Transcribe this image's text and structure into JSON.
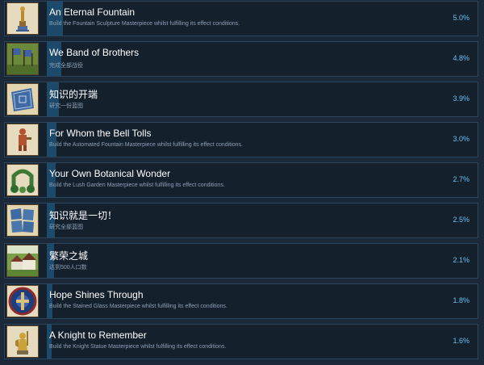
{
  "achievements": [
    {
      "title": "An Eternal Fountain",
      "description": "Build the Fountain Sculpture Masterpiece whilst fulfilling its effect conditions.",
      "percent_label": "5.0%",
      "percent": 5.0,
      "icon": "fountain-sculpture-icon"
    },
    {
      "title": "We Band of Brothers",
      "description": "完成全部战役",
      "percent_label": "4.8%",
      "percent": 4.8,
      "icon": "banners-field-icon"
    },
    {
      "title": "知识的开端",
      "description": "研究一份蓝图",
      "percent_label": "3.9%",
      "percent": 3.9,
      "icon": "blueprint-icon"
    },
    {
      "title": "For Whom the Bell Tolls",
      "description": "Build the Automated Fountain Masterpiece whilst fulfilling its effect conditions.",
      "percent_label": "3.0%",
      "percent": 3.0,
      "icon": "bell-ringer-icon"
    },
    {
      "title": "Your Own Botanical Wonder",
      "description": "Build the Lush Garden Masterpiece whilst fulfilling its effect conditions.",
      "percent_label": "2.7%",
      "percent": 2.7,
      "icon": "garden-arch-icon"
    },
    {
      "title": "知识就是一切！",
      "description": "研究全部蓝图",
      "percent_label": "2.5%",
      "percent": 2.5,
      "icon": "blueprints-stack-icon"
    },
    {
      "title": "繁荣之城",
      "description": "达到500人口数",
      "percent_label": "2.1%",
      "percent": 2.1,
      "icon": "town-houses-icon"
    },
    {
      "title": "Hope Shines Through",
      "description": "Build the Stained Glass Masterpiece whilst fulfilling its effect conditions.",
      "percent_label": "1.8%",
      "percent": 1.8,
      "icon": "stained-glass-icon"
    },
    {
      "title": "A Knight to Remember",
      "description": "Build the Knight Statue Masterpiece whilst fulfilling its effect conditions.",
      "percent_label": "1.6%",
      "percent": 1.6,
      "icon": "knight-statue-icon"
    }
  ],
  "colors": {
    "background": "#1b2838",
    "row": "#15202d",
    "row_border": "#2a475e",
    "bar_fill": "#1d4a6b",
    "title": "#ffffff",
    "description": "#8ba0b4",
    "percent": "#67c1f5"
  }
}
